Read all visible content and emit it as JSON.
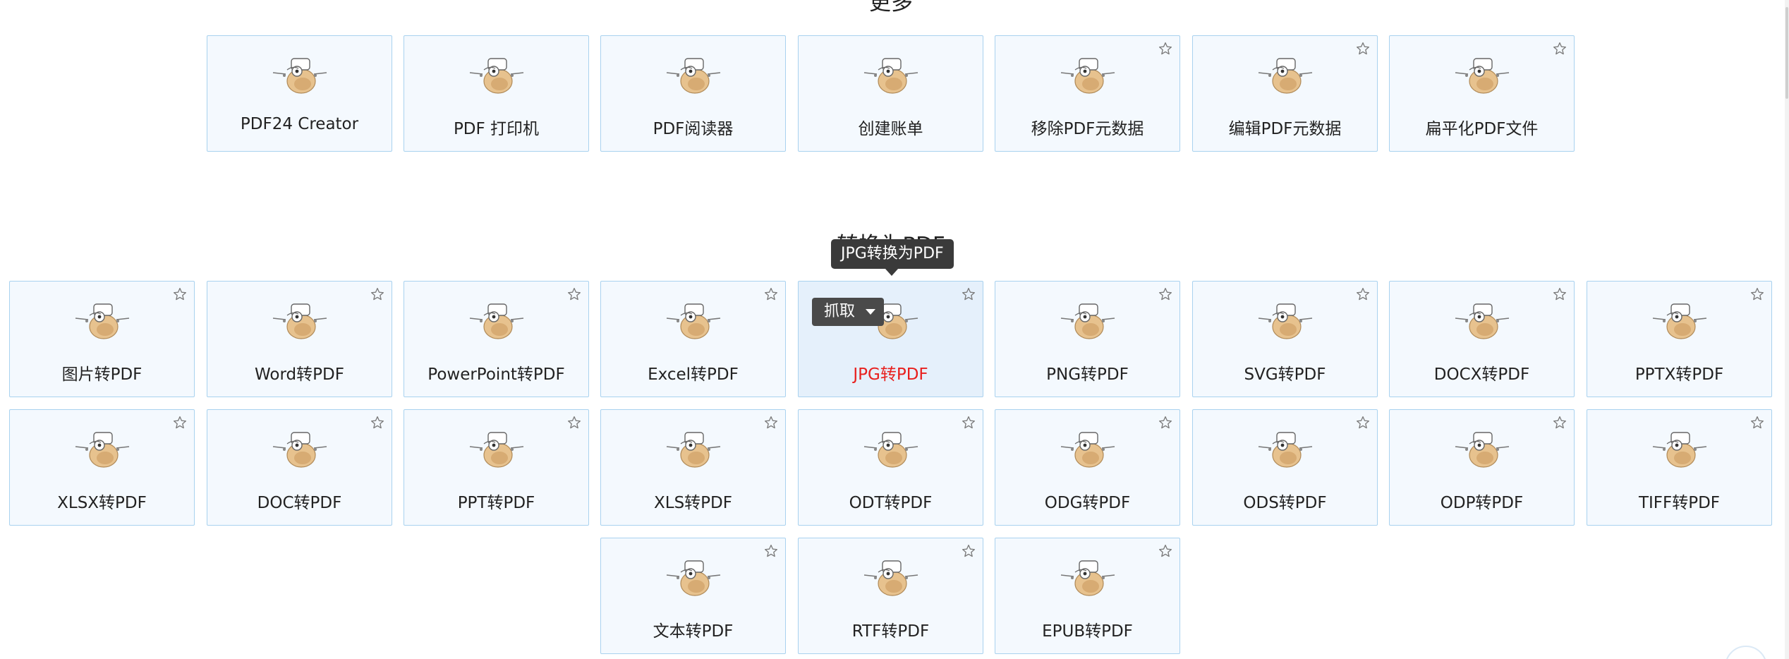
{
  "sections": {
    "more_title": "更多",
    "convert_title": "转换为PDF"
  },
  "more_tools": [
    {
      "label": "PDF24 Creator",
      "star": false
    },
    {
      "label": "PDF 打印机",
      "star": false
    },
    {
      "label": "PDF阅读器",
      "star": false
    },
    {
      "label": "创建账单",
      "star": false
    },
    {
      "label": "移除PDF元数据",
      "star": true
    },
    {
      "label": "编辑PDF元数据",
      "star": true
    },
    {
      "label": "扁平化PDF文件",
      "star": true
    }
  ],
  "convert_tools": [
    {
      "label": "图片转PDF"
    },
    {
      "label": "Word转PDF"
    },
    {
      "label": "PowerPoint转PDF"
    },
    {
      "label": "Excel转PDF"
    },
    {
      "label": "JPG转PDF",
      "hovered": true
    },
    {
      "label": "PNG转PDF"
    },
    {
      "label": "SVG转PDF"
    },
    {
      "label": "DOCX转PDF"
    },
    {
      "label": "PPTX转PDF"
    },
    {
      "label": "XLSX转PDF"
    },
    {
      "label": "DOC转PDF"
    },
    {
      "label": "PPT转PDF"
    },
    {
      "label": "XLS转PDF"
    },
    {
      "label": "ODT转PDF"
    },
    {
      "label": "ODG转PDF"
    },
    {
      "label": "ODS转PDF"
    },
    {
      "label": "ODP转PDF"
    },
    {
      "label": "TIFF转PDF"
    },
    {
      "label": "文本转PDF"
    },
    {
      "label": "RTF转PDF"
    },
    {
      "label": "EPUB转PDF"
    }
  ],
  "tooltip": {
    "text": "JPG转换为PDF"
  },
  "grab_button": {
    "label": "抓取"
  },
  "icons": {
    "tool": "pdf24-mascot-icon",
    "favorite": "star-outline-icon"
  },
  "colors": {
    "tile_bg": "#f4f9fe",
    "tile_border": "#a9d2ef",
    "hover_label": "#e8201e",
    "tooltip_bg": "#3a3a3a"
  }
}
